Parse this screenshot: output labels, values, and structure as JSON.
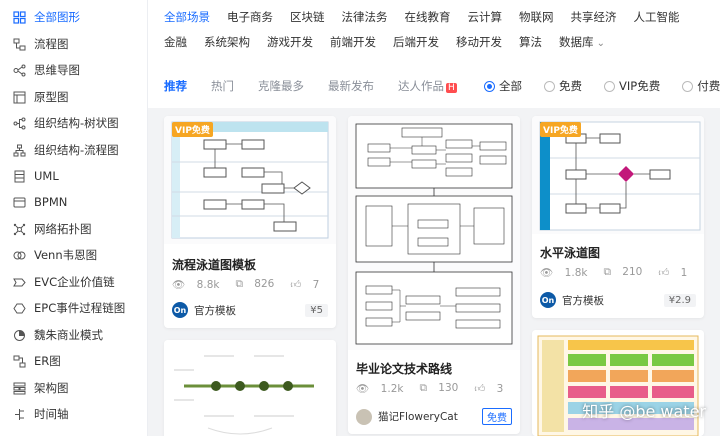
{
  "sidebar": {
    "items": [
      {
        "label": "全部图形",
        "icon": "grid-icon",
        "active": true
      },
      {
        "label": "流程图",
        "icon": "flowchart-icon"
      },
      {
        "label": "思维导图",
        "icon": "mindmap-icon"
      },
      {
        "label": "原型图",
        "icon": "prototype-icon"
      },
      {
        "label": "组织结构-树状图",
        "icon": "tree-icon"
      },
      {
        "label": "组织结构-流程图",
        "icon": "org-flow-icon"
      },
      {
        "label": "UML",
        "icon": "uml-icon"
      },
      {
        "label": "BPMN",
        "icon": "bpmn-icon"
      },
      {
        "label": "网络拓扑图",
        "icon": "network-icon"
      },
      {
        "label": "Venn韦恩图",
        "icon": "venn-icon"
      },
      {
        "label": "EVC企业价值链",
        "icon": "evc-icon"
      },
      {
        "label": "EPC事件过程链图",
        "icon": "epc-icon"
      },
      {
        "label": "魏朱商业模式",
        "icon": "business-model-icon"
      },
      {
        "label": "ER图",
        "icon": "er-icon"
      },
      {
        "label": "架构图",
        "icon": "architecture-icon"
      },
      {
        "label": "时间轴",
        "icon": "timeline-icon"
      }
    ]
  },
  "filters": {
    "row1": [
      "全部场景",
      "电子商务",
      "区块链",
      "法律法务",
      "在线教育",
      "云计算",
      "物联网",
      "共享经济",
      "人工智能"
    ],
    "row2": [
      "金融",
      "系统架构",
      "游戏开发",
      "前端开发",
      "后端开发",
      "移动开发",
      "算法",
      "数据库"
    ]
  },
  "sort_tabs": [
    "推荐",
    "热门",
    "克隆最多",
    "最新发布",
    "达人作品"
  ],
  "hot_badge": "H",
  "price_filter": [
    "全部",
    "免费",
    "VIP免费",
    "付费"
  ],
  "cards": [
    {
      "title": "流程泳道图模板",
      "badge": "VIP免费",
      "views": "8.8k",
      "clones": "826",
      "likes": "7",
      "author": "官方模板",
      "author_badge": "On",
      "price": "¥5"
    },
    {
      "title": "毕业论文技术路线",
      "views": "1.2k",
      "clones": "130",
      "likes": "3",
      "author": "猫记FloweryCat",
      "price": "免费"
    },
    {
      "title": "水平泳道图",
      "badge": "VIP免费",
      "views": "1.8k",
      "clones": "210",
      "likes": "1",
      "author": "官方模板",
      "author_badge": "On",
      "price": "¥2.9"
    }
  ],
  "watermark": "知乎 @be water",
  "colors": {
    "accent": "#1a6cff",
    "vip": "#f6a623",
    "swimlane": "#0d8fc9",
    "decision": "#c2187a"
  }
}
